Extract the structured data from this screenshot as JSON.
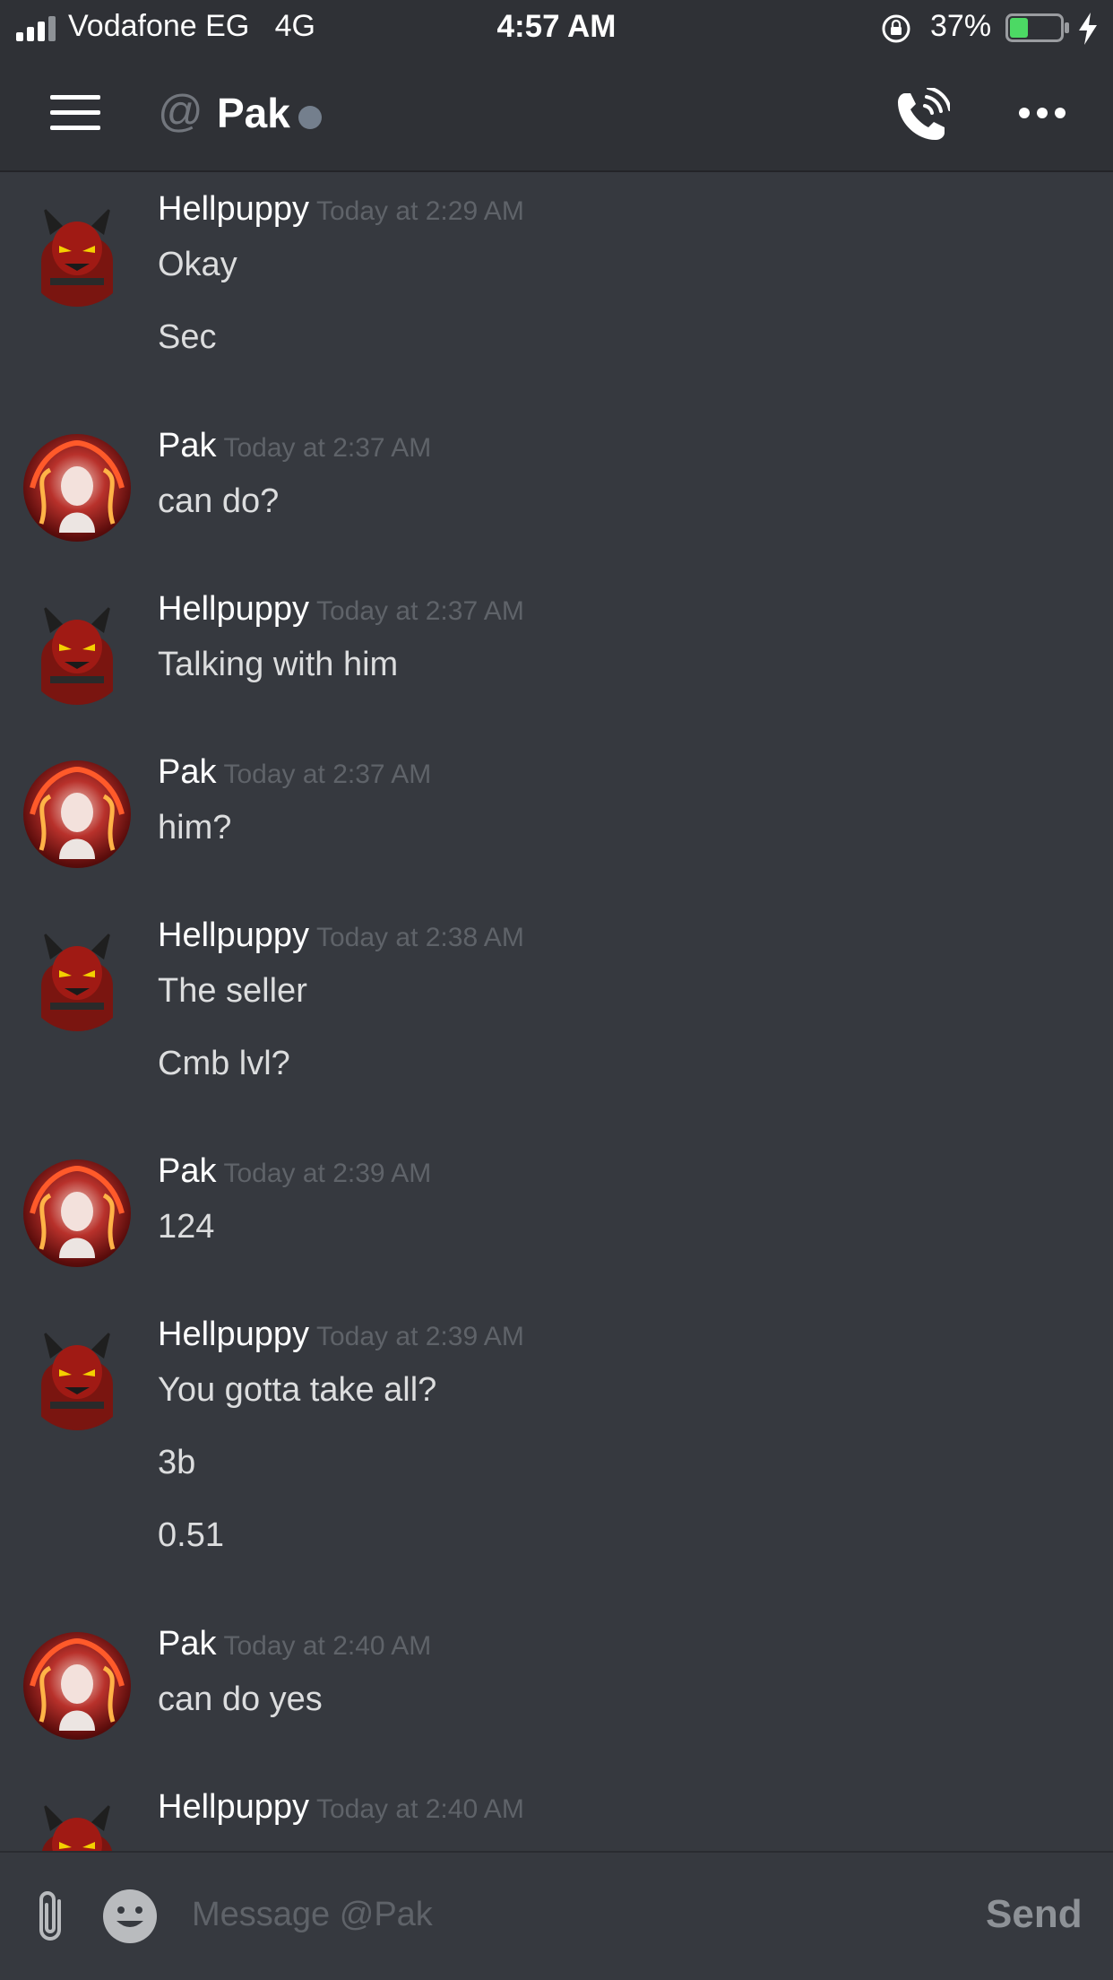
{
  "status_bar": {
    "carrier": "Vodafone EG",
    "network": "4G",
    "time": "4:57 AM",
    "battery_percent": "37%",
    "battery_level": 0.37,
    "icons": [
      "signal-icon",
      "rotation-lock-icon",
      "battery-icon",
      "charging-bolt-icon"
    ]
  },
  "header": {
    "channel_prefix_icon": "at-sign-icon",
    "title": "Pak",
    "presence": "offline",
    "presence_color": "#747f8d",
    "icons": [
      "hamburger-menu-icon",
      "call-icon",
      "more-options-icon"
    ]
  },
  "messages": [
    {
      "author": "Hellpuppy",
      "timestamp": "Today at 2:29 AM",
      "avatar": "devil-avatar",
      "lines": [
        "Okay",
        "Sec"
      ]
    },
    {
      "author": "Pak",
      "timestamp": "Today at 2:37 AM",
      "avatar": "anime-avatar",
      "lines": [
        "can do?"
      ]
    },
    {
      "author": "Hellpuppy",
      "timestamp": "Today at 2:37 AM",
      "avatar": "devil-avatar",
      "lines": [
        "Talking with him"
      ]
    },
    {
      "author": "Pak",
      "timestamp": "Today at 2:37 AM",
      "avatar": "anime-avatar",
      "lines": [
        "him?"
      ]
    },
    {
      "author": "Hellpuppy",
      "timestamp": "Today at 2:38 AM",
      "avatar": "devil-avatar",
      "lines": [
        "The seller",
        "Cmb lvl?"
      ]
    },
    {
      "author": "Pak",
      "timestamp": "Today at 2:39 AM",
      "avatar": "anime-avatar",
      "lines": [
        "124"
      ]
    },
    {
      "author": "Hellpuppy",
      "timestamp": "Today at 2:39 AM",
      "avatar": "devil-avatar",
      "lines": [
        "You gotta take all?",
        "3b",
        "0.51"
      ]
    },
    {
      "author": "Pak",
      "timestamp": "Today at 2:40 AM",
      "avatar": "anime-avatar",
      "lines": [
        "can do yes"
      ]
    },
    {
      "author": "Hellpuppy",
      "timestamp": "Today at 2:40 AM",
      "avatar": "devil-avatar",
      "lines": []
    }
  ],
  "composer": {
    "placeholder": "Message @Pak",
    "value": "",
    "send_label": "Send",
    "icons": [
      "attachment-icon",
      "emoji-icon"
    ]
  },
  "colors": {
    "background": "#36393f",
    "header_background": "#2f3136",
    "text": "#dcddde",
    "muted": "#5f6369"
  }
}
